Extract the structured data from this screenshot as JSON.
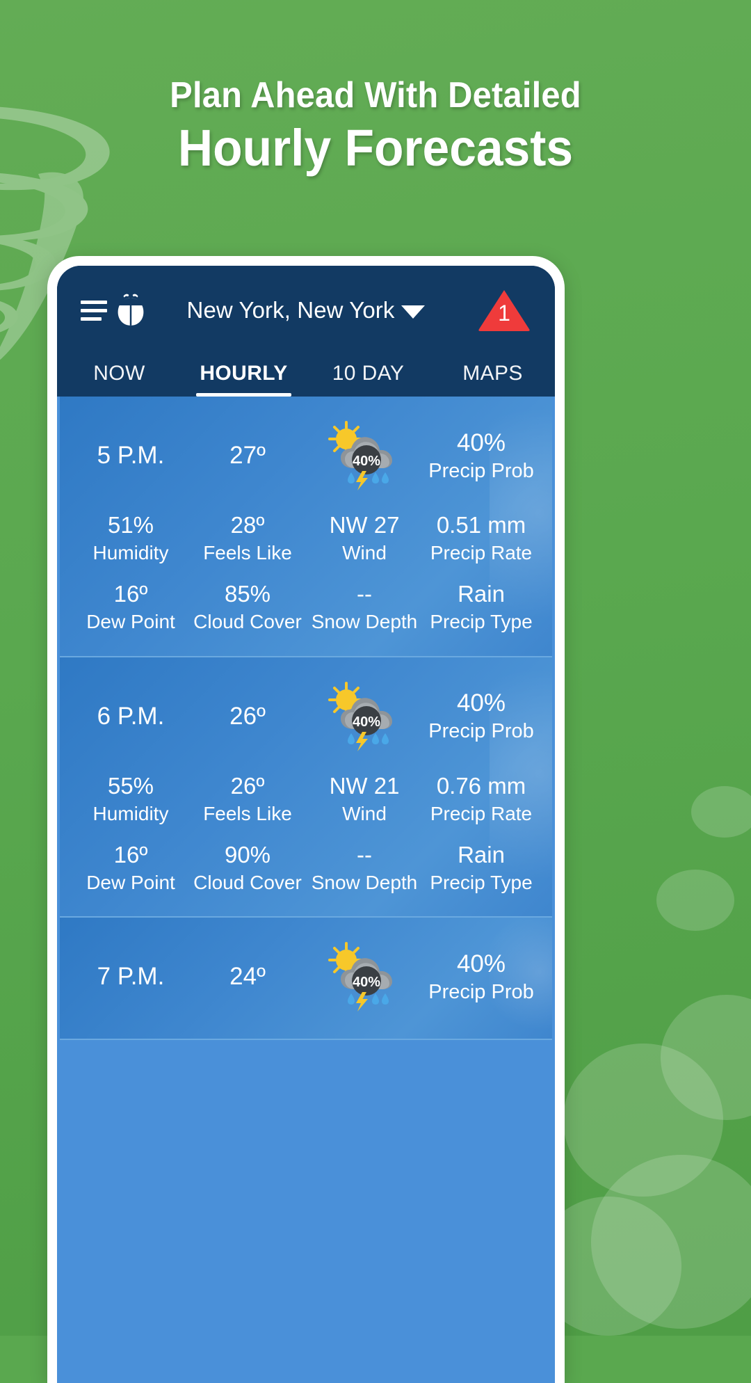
{
  "promo": {
    "line1": "Plan Ahead With Detailed",
    "line2": "Hourly Forecasts",
    "background_color": "#5aa84f",
    "decor": [
      "tornado-shape",
      "cloud-shapes"
    ]
  },
  "app": {
    "header": {
      "menu_icon": "hamburger-menu-icon",
      "logo_icon": "weatherbug-ladybug-logo",
      "location": "New York, New York",
      "location_caret_icon": "chevron-down-icon",
      "alert_icon": "alert-triangle-icon",
      "alert_count": "1",
      "alert_color": "#ef3b3b",
      "background_color": "#123a63"
    },
    "tabs": [
      {
        "label": "NOW",
        "active": false
      },
      {
        "label": "HOURLY",
        "active": true
      },
      {
        "label": "10 DAY",
        "active": false
      },
      {
        "label": "MAPS",
        "active": false
      }
    ],
    "hourly": [
      {
        "time": "5 P.M.",
        "temp": "27º",
        "icon": "sun-cloud-thunder-rain-icon",
        "icon_badge": "40%",
        "precip_prob_value": "40%",
        "precip_prob_label": "Precip Prob",
        "details": [
          {
            "value": "51%",
            "label": "Humidity"
          },
          {
            "value": "28º",
            "label": "Feels Like"
          },
          {
            "value": "NW 27",
            "label": "Wind"
          },
          {
            "value": "0.51 mm",
            "label": "Precip Rate"
          },
          {
            "value": "16º",
            "label": "Dew Point"
          },
          {
            "value": "85%",
            "label": "Cloud Cover"
          },
          {
            "value": "--",
            "label": "Snow Depth"
          },
          {
            "value": "Rain",
            "label": "Precip Type"
          }
        ]
      },
      {
        "time": "6 P.M.",
        "temp": "26º",
        "icon": "sun-cloud-thunder-rain-icon",
        "icon_badge": "40%",
        "precip_prob_value": "40%",
        "precip_prob_label": "Precip Prob",
        "details": [
          {
            "value": "55%",
            "label": "Humidity"
          },
          {
            "value": "26º",
            "label": "Feels Like"
          },
          {
            "value": "NW 21",
            "label": "Wind"
          },
          {
            "value": "0.76 mm",
            "label": "Precip Rate"
          },
          {
            "value": "16º",
            "label": "Dew Point"
          },
          {
            "value": "90%",
            "label": "Cloud Cover"
          },
          {
            "value": "--",
            "label": "Snow Depth"
          },
          {
            "value": "Rain",
            "label": "Precip Type"
          }
        ]
      },
      {
        "time": "7 P.M.",
        "temp": "24º",
        "icon": "sun-cloud-thunder-rain-icon",
        "icon_badge": "40%",
        "precip_prob_value": "40%",
        "precip_prob_label": "Precip Prob",
        "details": []
      }
    ]
  }
}
